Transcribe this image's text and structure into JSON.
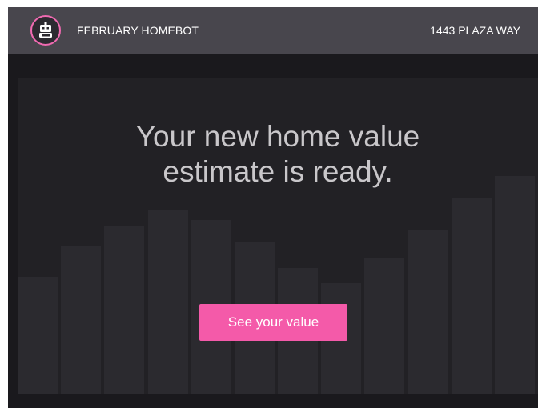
{
  "header": {
    "brand_name": "FEBRUARY HOMEBOT",
    "address": "1443 PLAZA WAY",
    "logo_icon": "robot-icon"
  },
  "hero": {
    "headline_line1": "Your new home value",
    "headline_line2": "estimate is ready.",
    "cta_label": "See your value"
  },
  "colors": {
    "accent": "#f45aa9",
    "header_bg": "#48464d",
    "page_bg": "#1a191d",
    "hero_bg": "#222125",
    "bar_color": "#2b2a2f"
  },
  "decorative_bars": [
    0.37,
    0.47,
    0.53,
    0.58,
    0.55,
    0.48,
    0.4,
    0.35,
    0.43,
    0.52,
    0.62,
    0.69
  ]
}
